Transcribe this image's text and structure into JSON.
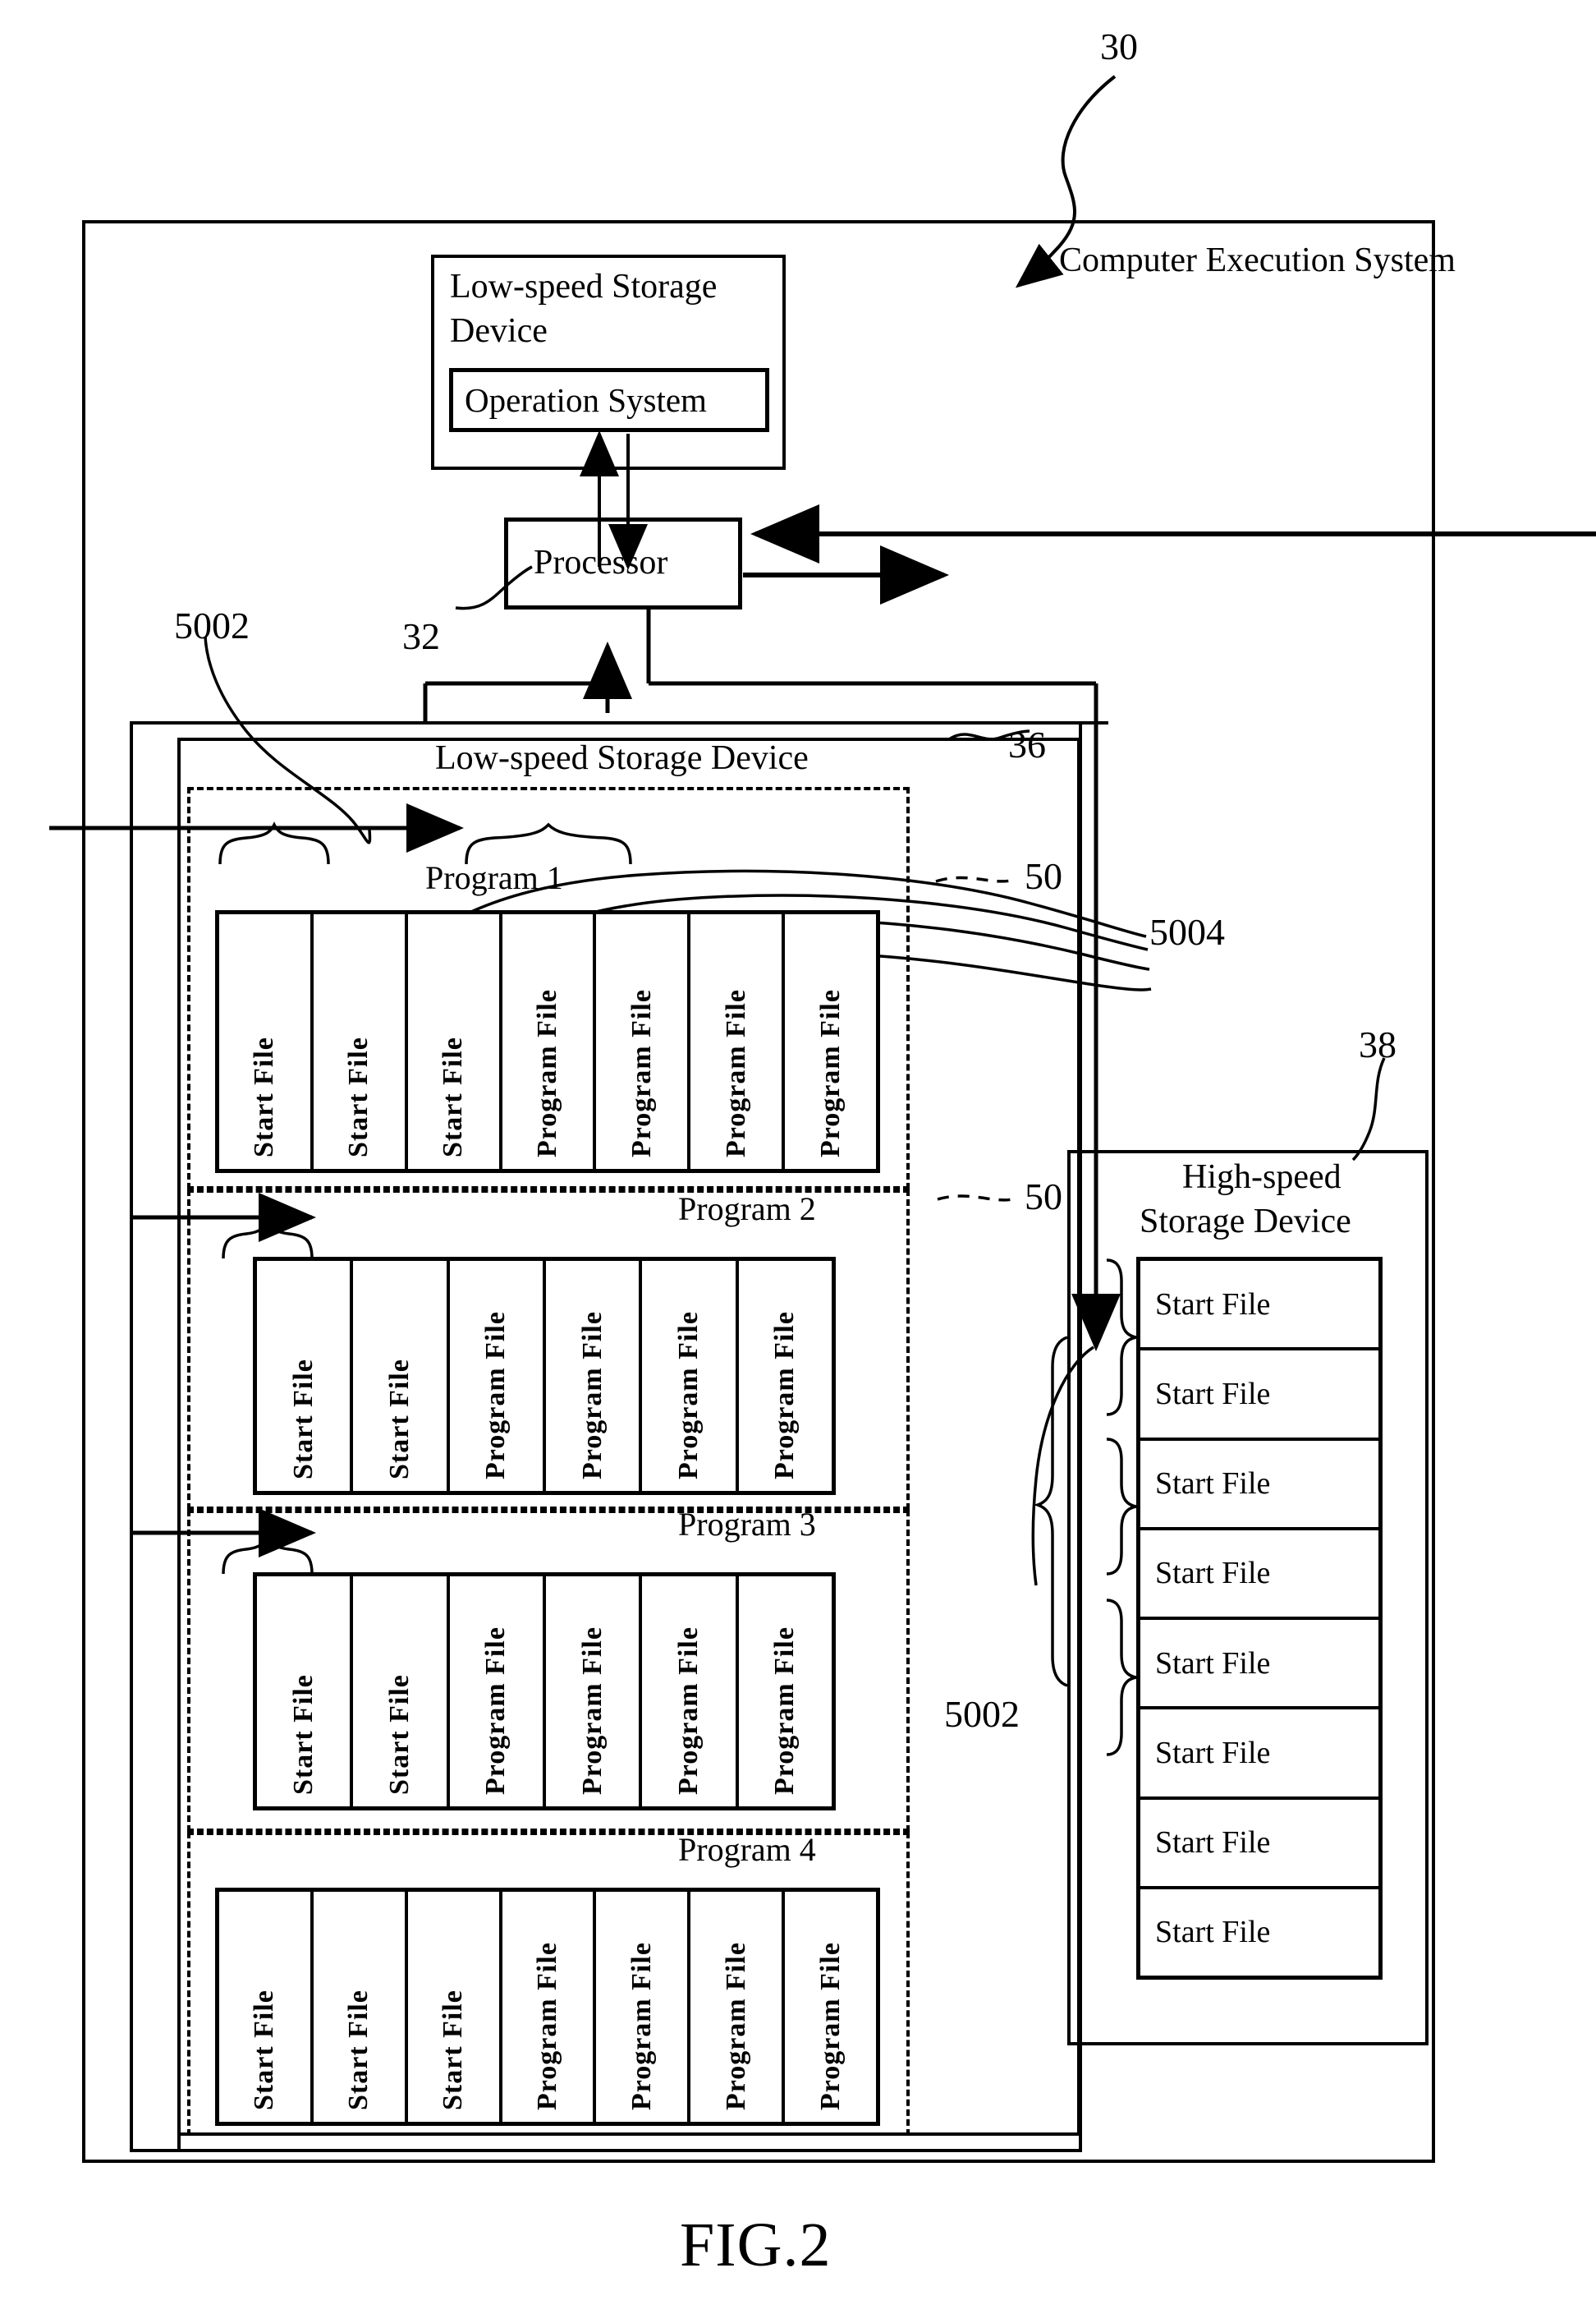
{
  "figure": {
    "caption": "FIG.2",
    "ref_30": "30"
  },
  "system": {
    "title": "Computer Execution System",
    "ref": "30"
  },
  "top_storage": {
    "title_line1": "Low-speed Storage",
    "title_line2": "Device",
    "inner_label": "Operation System"
  },
  "processor": {
    "label": "Processor",
    "ref": "32"
  },
  "low_speed": {
    "title": "Low-speed Storage Device",
    "ref": "36",
    "ref_5002": "5002",
    "ref_5004": "5004",
    "ref_50_a": "50",
    "ref_50_b": "50",
    "programs": [
      {
        "title": "Program 1",
        "files": [
          "Start File",
          "Start File",
          "Start File",
          "Program File",
          "Program File",
          "Program File",
          "Program File"
        ]
      },
      {
        "title": "Program 2",
        "files": [
          "Start File",
          "Start File",
          "Program File",
          "Program File",
          "Program File",
          "Program File"
        ]
      },
      {
        "title": "Program 3",
        "files": [
          "Start File",
          "Start File",
          "Program File",
          "Program File",
          "Program File",
          "Program File"
        ]
      },
      {
        "title": "Program 4",
        "files": [
          "Start File",
          "Start File",
          "Start File",
          "Program File",
          "Program File",
          "Program File",
          "Program File"
        ]
      }
    ]
  },
  "high_speed": {
    "title_line1": "High-speed",
    "title_line2": "Storage Device",
    "ref": "38",
    "ref_5002": "5002",
    "files": [
      "Start File",
      "Start File",
      "Start File",
      "Start File",
      "Start File",
      "Start File",
      "Start File",
      "Start File"
    ]
  }
}
